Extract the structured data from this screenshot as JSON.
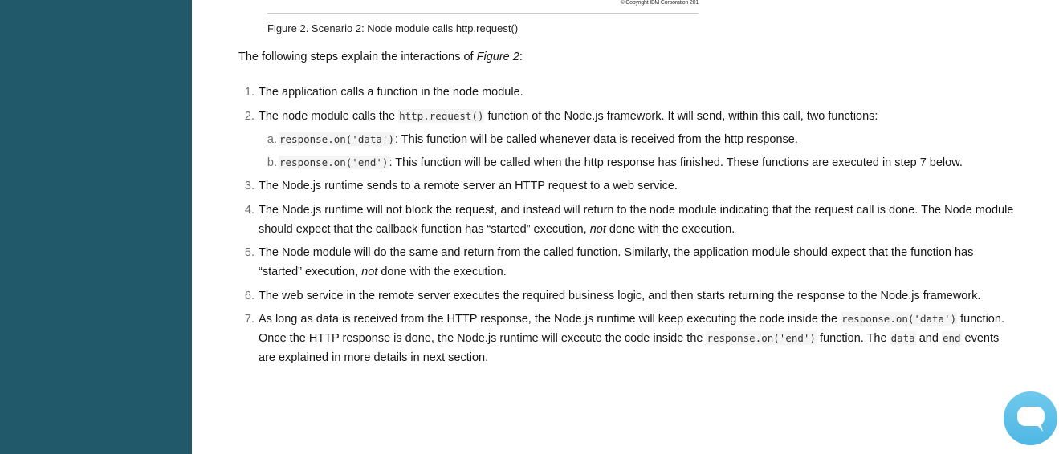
{
  "figure": {
    "copyright": "© Copyright IBM Corporation 201",
    "caption": "Figure 2. Scenario 2: Node module calls http.request()"
  },
  "intro": {
    "text": "The following steps explain the interactions of ",
    "ref": "Figure 2",
    "suffix": ":"
  },
  "steps": [
    {
      "num": "1.",
      "text": "The application calls a function in the node module."
    },
    {
      "num": "2.",
      "pre": "The node module calls the ",
      "code": "http.request()",
      "post": " function of the Node.js framework. It will send, within this call, two functions:",
      "sub": [
        {
          "num": "a.",
          "code": "response.on('data')",
          "text": ": This function will be called whenever data is received from the http response."
        },
        {
          "num": "b.",
          "code": "response.on('end')",
          "text": ": This function will be called when the http response has finished. These functions are executed in step 7 below."
        }
      ]
    },
    {
      "num": "3.",
      "text": "The Node.js runtime sends to a remote server an HTTP request to a web service."
    },
    {
      "num": "4.",
      "pre": "The Node.js runtime will not block the request, and instead will return to the node module indicating that the request call is done. The Node module should expect that the callback function has “started” execution, ",
      "em": "not",
      "post": " done with the execution."
    },
    {
      "num": "5.",
      "pre": "The Node module will do the same and return from the called function. Similarly, the application module should expect that the function has “started” execution, ",
      "em": "not",
      "post": " done with the execution."
    },
    {
      "num": "6.",
      "text": "The web service in the remote server executes the required business logic, and then starts returning the response to the Node.js framework."
    },
    {
      "num": "7.",
      "t1": "As long as data is received from the HTTP response, the Node.js runtime will keep executing the code inside the ",
      "c1": "response.on('data')",
      "t2": " function. Once the HTTP response is done, the Node.js runtime will execute the code inside the ",
      "c2": "response.on('end')",
      "t3": " function. The ",
      "c3": "data",
      "t4": " and ",
      "c4": "end",
      "t5": " events are explained in more details in next section."
    }
  ],
  "chat": {
    "icon": "chat-bubble-icon"
  }
}
